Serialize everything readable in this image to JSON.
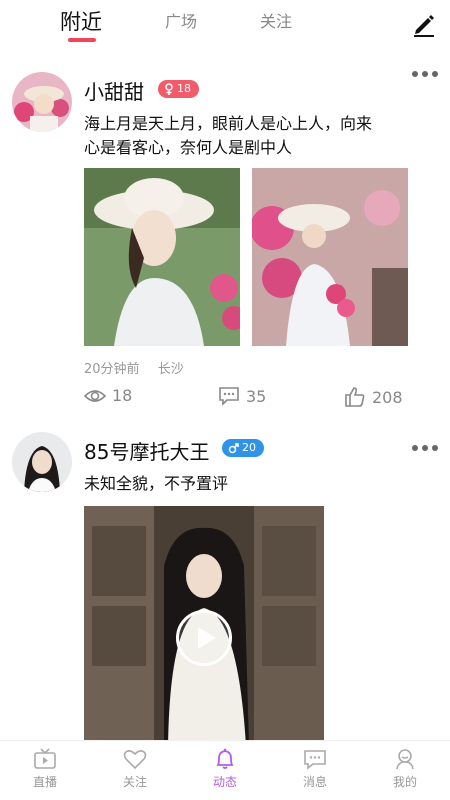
{
  "tabs": [
    {
      "label": "附近",
      "active": true
    },
    {
      "label": "广场",
      "active": false
    },
    {
      "label": "关注",
      "active": false
    }
  ],
  "posts": [
    {
      "username": "小甜甜",
      "gender": "female",
      "age": "18",
      "text_line1": "海上月是天上月，眼前人是心上人，向来",
      "text_line2": "心是看客心，奈何人是剧中人",
      "time": "20分钟前",
      "location": "长沙",
      "views": "18",
      "comments": "35",
      "likes": "208"
    },
    {
      "username": "85号摩托大王",
      "gender": "male",
      "age": "20",
      "text_line1": "未知全貌，不予置评"
    }
  ],
  "bottom_nav": [
    {
      "label": "直播",
      "icon": "tv-icon",
      "active": false
    },
    {
      "label": "关注",
      "icon": "heart-icon",
      "active": false
    },
    {
      "label": "动态",
      "icon": "bell-icon",
      "active": true
    },
    {
      "label": "消息",
      "icon": "message-icon",
      "active": false
    },
    {
      "label": "我的",
      "icon": "user-icon",
      "active": false
    }
  ],
  "colors": {
    "accent_red": "#f2455b",
    "female_badge": "#f25c6a",
    "male_badge": "#2f94e8",
    "nav_active": "#b45ce8"
  }
}
